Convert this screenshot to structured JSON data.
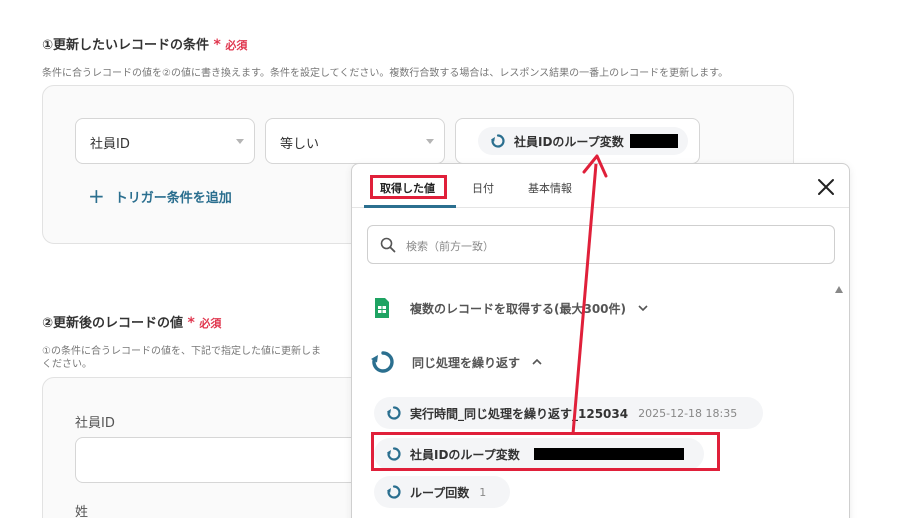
{
  "section1": {
    "title": "①更新したいレコードの条件",
    "required_mark": "*",
    "required_text": "必須",
    "description": "条件に合うレコードの値を②の値に書き換えます。条件を設定してください。複数行合致する場合は、レスポンス結果の一番上のレコードを更新します。",
    "field_select": "社員ID",
    "operator_select": "等しい",
    "value_chip": "社員IDのループ変数",
    "add_trigger_plus": "+",
    "add_trigger_label": "トリガー条件を追加"
  },
  "section2": {
    "title": "②更新後のレコードの値",
    "required_mark": "*",
    "required_text": "必須",
    "description_line1": "①の条件に合うレコードの値を、下記で指定した値に更新しま",
    "description_line2": "ください。",
    "field1_label": "社員ID",
    "field2_label": "姓"
  },
  "popup": {
    "tabs": [
      "取得した値",
      "日付",
      "基本情報"
    ],
    "active_tab": "取得した値",
    "search_placeholder": "検索（前方一致）",
    "groups": [
      {
        "label": "複数のレコードを取得する(最大300件)",
        "icon": "spreadsheet-icon",
        "expanded": false
      },
      {
        "label": "同じ処理を繰り返す",
        "icon": "loop-icon",
        "expanded": true
      }
    ],
    "items": [
      {
        "label": "実行時間_同じ処理を繰り返す_125034",
        "sub": "2025-12-18 18:35"
      },
      {
        "label": "社員IDのループ変数",
        "sub": ""
      },
      {
        "label": "ループ回数",
        "sub": "1"
      }
    ]
  },
  "colors": {
    "accent": "#2b6f8f",
    "required": "#e0364e",
    "annotation": "#e0203a",
    "sheet_green": "#1ea362"
  }
}
